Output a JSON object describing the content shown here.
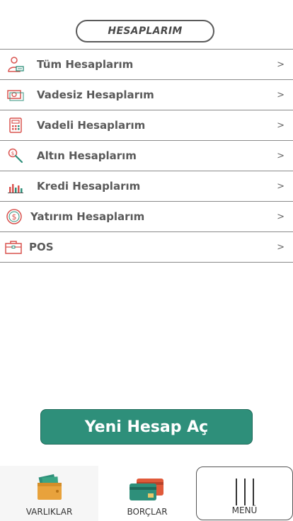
{
  "header": {
    "title": "HESAPLARIM"
  },
  "accounts": [
    {
      "label": "Tüm Hesaplarım",
      "icon": "user-account-icon",
      "chevron": ">"
    },
    {
      "label": "Vadesiz Hesaplarım",
      "icon": "cash-icon",
      "chevron": ">"
    },
    {
      "label": "Vadeli Hesaplarım",
      "icon": "calculator-icon",
      "chevron": ">"
    },
    {
      "label": "Altın Hesaplarım",
      "icon": "gold-search-icon",
      "chevron": ">"
    },
    {
      "label": "Kredi Hesaplarım",
      "icon": "bar-chart-icon",
      "chevron": ">"
    },
    {
      "label": "Yatırım Hesaplarım",
      "icon": "dollar-coin-icon",
      "chevron": ">"
    },
    {
      "label": "POS",
      "icon": "briefcase-icon",
      "chevron": ">"
    }
  ],
  "actions": {
    "new_account_label": "Yeni Hesap Aç"
  },
  "tabbar": {
    "assets_label": "VARLIKLAR",
    "debts_label": "BORÇLAR",
    "menu_label": "MENÜ"
  },
  "colors": {
    "accent": "#2e8f7a",
    "icon_red": "#d9534f",
    "icon_teal": "#2e8f7a",
    "text": "#5a5a5a"
  }
}
